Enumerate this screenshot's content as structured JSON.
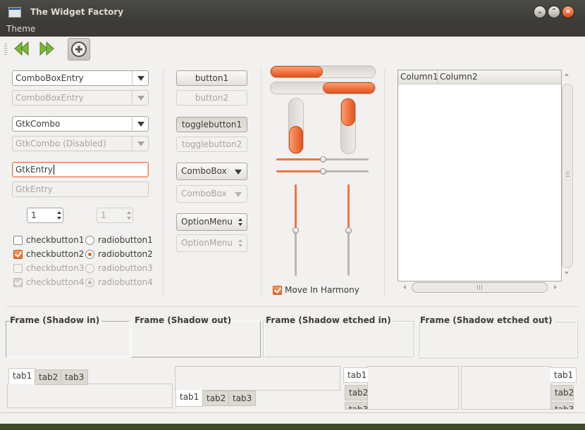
{
  "window": {
    "title": "The Widget Factory"
  },
  "menubar": {
    "theme": "Theme"
  },
  "col1": {
    "combobox_entry": "ComboBoxEntry",
    "combobox_entry_disabled": "ComboBoxEntry",
    "gtk_combo": "GtkCombo",
    "gtk_combo_disabled": "GtkCombo (Disabled)",
    "gtk_entry": "GtkEntry",
    "gtk_entry_disabled": "GtkEntry",
    "spin_value": "1",
    "spin_disabled_value": "1",
    "checkbuttons": [
      {
        "label": "checkbutton1",
        "checked": false,
        "disabled": false
      },
      {
        "label": "checkbutton2",
        "checked": true,
        "disabled": false
      },
      {
        "label": "checkbutton3",
        "checked": false,
        "disabled": true
      },
      {
        "label": "checkbutton4",
        "checked": true,
        "disabled": true
      }
    ],
    "radiobuttons": [
      {
        "label": "radiobutton1",
        "selected": false,
        "disabled": false
      },
      {
        "label": "radiobutton2",
        "selected": true,
        "disabled": false
      },
      {
        "label": "radiobutton3",
        "selected": false,
        "disabled": true
      },
      {
        "label": "radiobutton4",
        "selected": true,
        "disabled": true
      }
    ]
  },
  "col2": {
    "button1": "button1",
    "button2": "button2",
    "togglebutton1": "togglebutton1",
    "togglebutton2": "togglebutton2",
    "combobox": "ComboBox",
    "combobox_disabled": "ComboBox",
    "optionmenu": "OptionMenu",
    "optionmenu_disabled": "OptionMenu"
  },
  "col3": {
    "progress_h1": 0.5,
    "progress_h2": 0.5,
    "progress_v1": 0.5,
    "progress_v2": 0.5,
    "slider_h1": 0.5,
    "slider_h2": 0.5,
    "slider_v1": 0.5,
    "slider_v2": 0.5,
    "move_in_harmony": "Move In Harmony",
    "move_in_harmony_checked": true
  },
  "tree": {
    "columns": [
      "Column1",
      "Column2"
    ]
  },
  "frames": [
    {
      "title": "Frame (Shadow in)"
    },
    {
      "title": "Frame (Shadow out)"
    },
    {
      "title": "Frame (Shadow etched in)"
    },
    {
      "title": "Frame (Shadow etched out)"
    }
  ],
  "notebooks": {
    "tabs": [
      "tab1",
      "tab2",
      "tab3"
    ]
  },
  "colors": {
    "accent": "#ee7644",
    "titlebar": "#3c3b37",
    "window_bg": "#f2f1f0"
  }
}
